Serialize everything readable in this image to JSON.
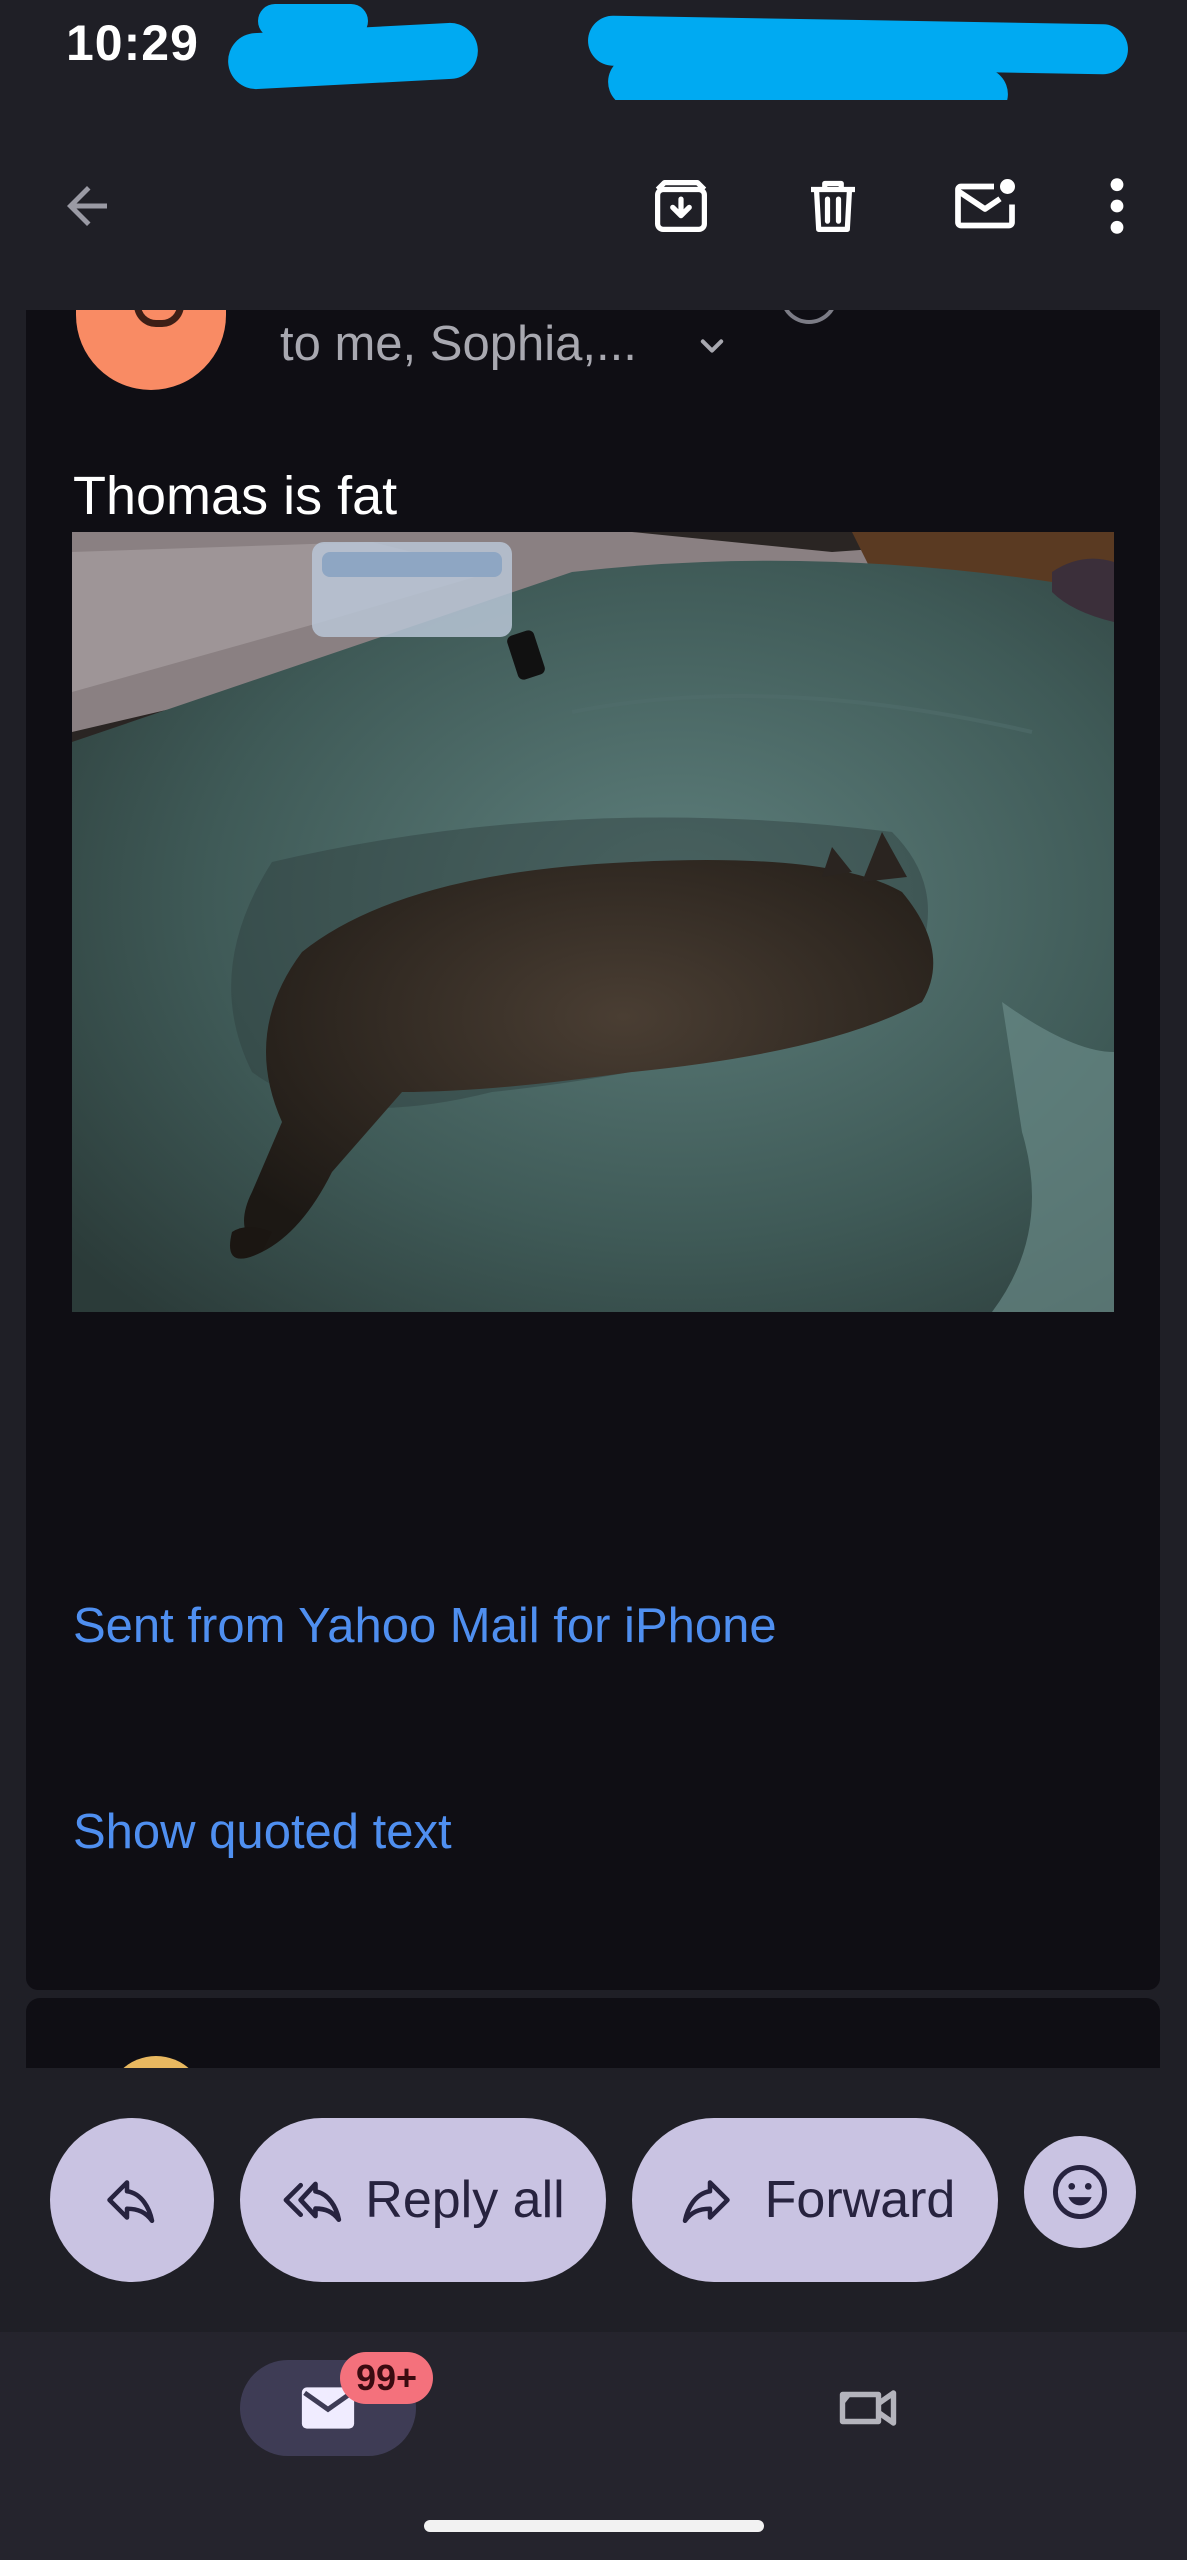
{
  "status_bar": {
    "time": "10:29"
  },
  "toolbar": {
    "back_icon": "arrow-left-icon",
    "archive_icon": "archive-icon",
    "delete_icon": "trash-icon",
    "mark_unread_icon": "mark-unread-icon",
    "more_icon": "more-vert-icon"
  },
  "message": {
    "recipients": "to me, Sophia,...",
    "body": "Thomas is fat",
    "signature": "Sent from Yahoo Mail for iPhone",
    "show_quoted": "Show quoted text",
    "avatar_color": "#f98b64"
  },
  "actions": {
    "reply_icon": "reply-icon",
    "reply_all": "Reply all",
    "forward": "Forward",
    "emoji_icon": "emoji-icon"
  },
  "bottom_nav": {
    "mail_badge": "99+",
    "mail_icon": "mail-icon",
    "meet_icon": "video-camera-icon"
  },
  "colors": {
    "background": "#1f1f26",
    "card": "#0f0e14",
    "link": "#4f8ff0",
    "pill": "#c9c3e2",
    "badge": "#f4717c"
  }
}
